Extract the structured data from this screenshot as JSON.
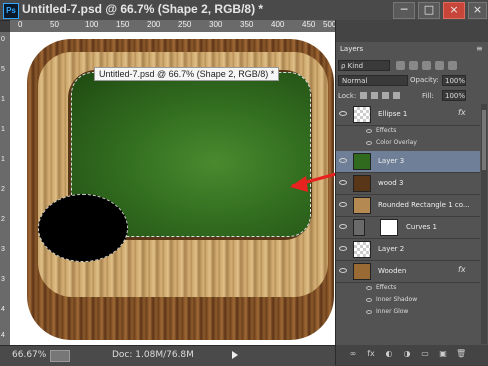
{
  "window": {
    "app_logo": "Ps",
    "title": "Untitled-7.psd @ 66.7% (Shape 2, RGB/8) *",
    "controls": {
      "minimize": "─",
      "maximize": "□",
      "close": "×",
      "close2": "×"
    }
  },
  "ruler": {
    "h_ticks": [
      "0",
      "50",
      "100",
      "150",
      "200",
      "250",
      "300",
      "350",
      "400",
      "450",
      "500"
    ],
    "v_ticks": [
      "0",
      "5",
      "1",
      "1",
      "1",
      "2",
      "2",
      "3",
      "3",
      "4",
      "4"
    ]
  },
  "canvas": {
    "tooltip": "Untitled-7.psd @ 66.7% (Shape 2, RGB/8) *",
    "colors": {
      "felt": "#336e20",
      "wood_dark": "#6b3d1a",
      "wood_light": "#d4b076",
      "arrow": "#e8221e"
    }
  },
  "status": {
    "zoom": "66.67%",
    "doc_info": "Doc: 1.08M/76.8M"
  },
  "layers_panel": {
    "tab": "Layers",
    "menu": "≡",
    "filter_kind": "ρ Kind",
    "blend_mode": "Normal",
    "opacity_label": "Opacity:",
    "opacity_value": "100%",
    "lock_label": "Lock:",
    "fill_label": "Fill:",
    "fill_value": "100%",
    "layers": [
      {
        "name": "Ellipse 1",
        "fx": "fx",
        "thumb": "#dcdcdc"
      },
      {
        "name": "Layer 3",
        "fx": "",
        "thumb": "#2f6a1e",
        "selected": true
      },
      {
        "name": "wood 3",
        "fx": "",
        "thumb": "#5a3618"
      },
      {
        "name": "Rounded Rectangle 1 co...",
        "fx": "",
        "thumb": "#b48a52"
      },
      {
        "name": "Curves 1",
        "fx": "",
        "thumb": "#ffffff"
      },
      {
        "name": "Layer 2",
        "fx": "",
        "thumb": "#dcdcdc"
      },
      {
        "name": "Wooden",
        "fx": "fx",
        "thumb": "#9a6a35"
      }
    ],
    "effects_label": "Effects",
    "effects_ellipse": [
      "Color Overlay"
    ],
    "effects_wooden": [
      "Inner Shadow",
      "Inner Glow"
    ],
    "bottom_buttons": [
      "∞",
      "fx",
      "◐",
      "◑",
      "▭",
      "▣",
      "🗑"
    ]
  }
}
